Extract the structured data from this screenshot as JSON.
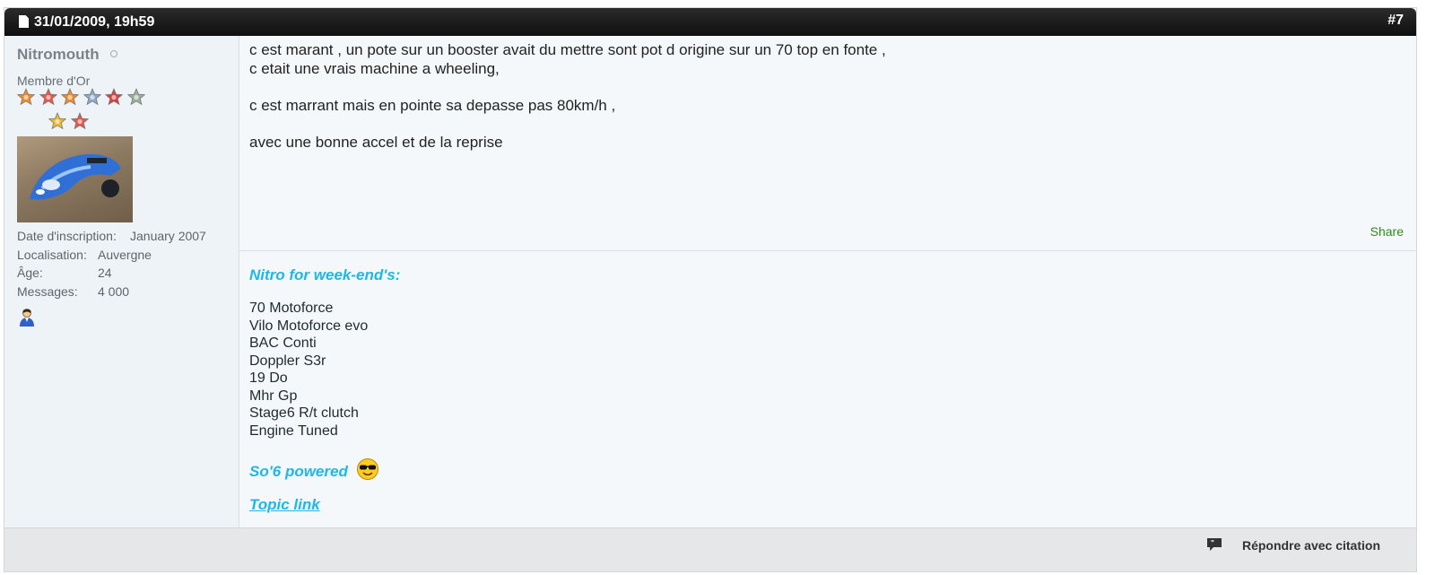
{
  "header": {
    "date": "31/01/2009, 19h59",
    "post_number": "#7"
  },
  "user": {
    "name": "Nitromouth",
    "title": "Membre d'Or",
    "stars": {
      "row1_colors": [
        "#f08a2a",
        "#e9554a",
        "#f08a2a",
        "#8fa8c8",
        "#d64040",
        "#9ab09a"
      ],
      "row2_colors": [
        "#f2b92a",
        "#e9554a"
      ]
    },
    "info": [
      {
        "label": "Date d'inscription:",
        "value": "January 2007"
      },
      {
        "label": "Localisation:",
        "value": "Auvergne"
      },
      {
        "label": "Âge:",
        "value": "24"
      },
      {
        "label": "Messages:",
        "value": "4 000"
      }
    ]
  },
  "message": {
    "lines": [
      "c est marant , un pote sur un booster avait du mettre sont pot d origine sur un 70 top en fonte ,",
      "c etait une vrais machine a wheeling,",
      "",
      "c est marrant mais en pointe sa depasse pas 80km/h ,",
      "",
      "avec une bonne accel et de la reprise"
    ],
    "share_label": "Share"
  },
  "signature": {
    "title": "Nitro for week-end's:",
    "items": [
      "70 Motoforce",
      "Vilo Motoforce evo",
      "BAC Conti",
      "Doppler S3r",
      "19 Do",
      "Mhr Gp",
      "Stage6 R/t clutch",
      "Engine Tuned"
    ],
    "powered": "So'6 powered",
    "topic_link": "Topic link"
  },
  "footer": {
    "reply_with_quote": "Répondre avec citation"
  },
  "colors": {
    "accent": "#1db8e6",
    "share": "#2f8a1e",
    "header_bg": "#1a1a1a"
  }
}
